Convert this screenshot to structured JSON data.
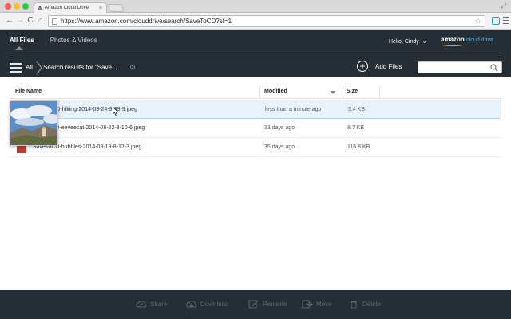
{
  "browser": {
    "tab_favicon": "a",
    "tab_title": "Amazon Cloud Drive",
    "tab_close": "×",
    "url": "https://www.amazon.com/clouddrive/search/SaveToCD?sf=1",
    "nav_back": "←",
    "nav_forward": "→",
    "nav_reload": "C",
    "nav_home": "⌂",
    "bookmark_star": "☆",
    "fullscreen_icon": "⤢"
  },
  "header": {
    "tabs": [
      {
        "label": "All Files",
        "active": true
      },
      {
        "label": "Photos & Videos",
        "active": false
      }
    ],
    "greeting": "Hello, Cindy",
    "greeting_chevron": "⌄",
    "logo_brand": "amazon",
    "logo_sub": "cloud drive"
  },
  "subheader": {
    "breadcrumb_root": "All",
    "breadcrumb_current": "Search results for \"Save...",
    "result_count": "(3)",
    "add_files_icon": "+",
    "add_files_label": "Add Files",
    "search_value": "",
    "search_placeholder": ""
  },
  "table": {
    "columns": {
      "name": "File Name",
      "modified": "Modified",
      "size": "Size"
    },
    "rows": [
      {
        "name": "SaveToCD-hiking-2014-09-24-9-39-9.jpeg",
        "modified": "less than a minute ago",
        "size": "5.4 KB",
        "selected": true
      },
      {
        "name": "SaveToCD-eeveecat-2014-08-22-3-10-6.jpeg",
        "modified": "33 days ago",
        "size": "8.7 KB",
        "selected": false
      },
      {
        "name": "SaveToCD-bubbles-2014-08-19-8-12-3.jpeg",
        "modified": "35 days ago",
        "size": "116.8 KB",
        "selected": false
      }
    ]
  },
  "actions": [
    {
      "label": "Share",
      "icon": "share-cloud-icon"
    },
    {
      "label": "Download",
      "icon": "download-cloud-icon"
    },
    {
      "label": "Rename",
      "icon": "rename-pencil-icon"
    },
    {
      "label": "Move",
      "icon": "move-arrow-icon"
    },
    {
      "label": "Delete",
      "icon": "trash-icon"
    }
  ],
  "colors": {
    "header_bg": "#262e35",
    "selected_row_bg": "#e7f2fa",
    "logo_accent": "#4bb5ea",
    "file_icon": "#c0392b",
    "disabled_action": "#5d666e"
  }
}
